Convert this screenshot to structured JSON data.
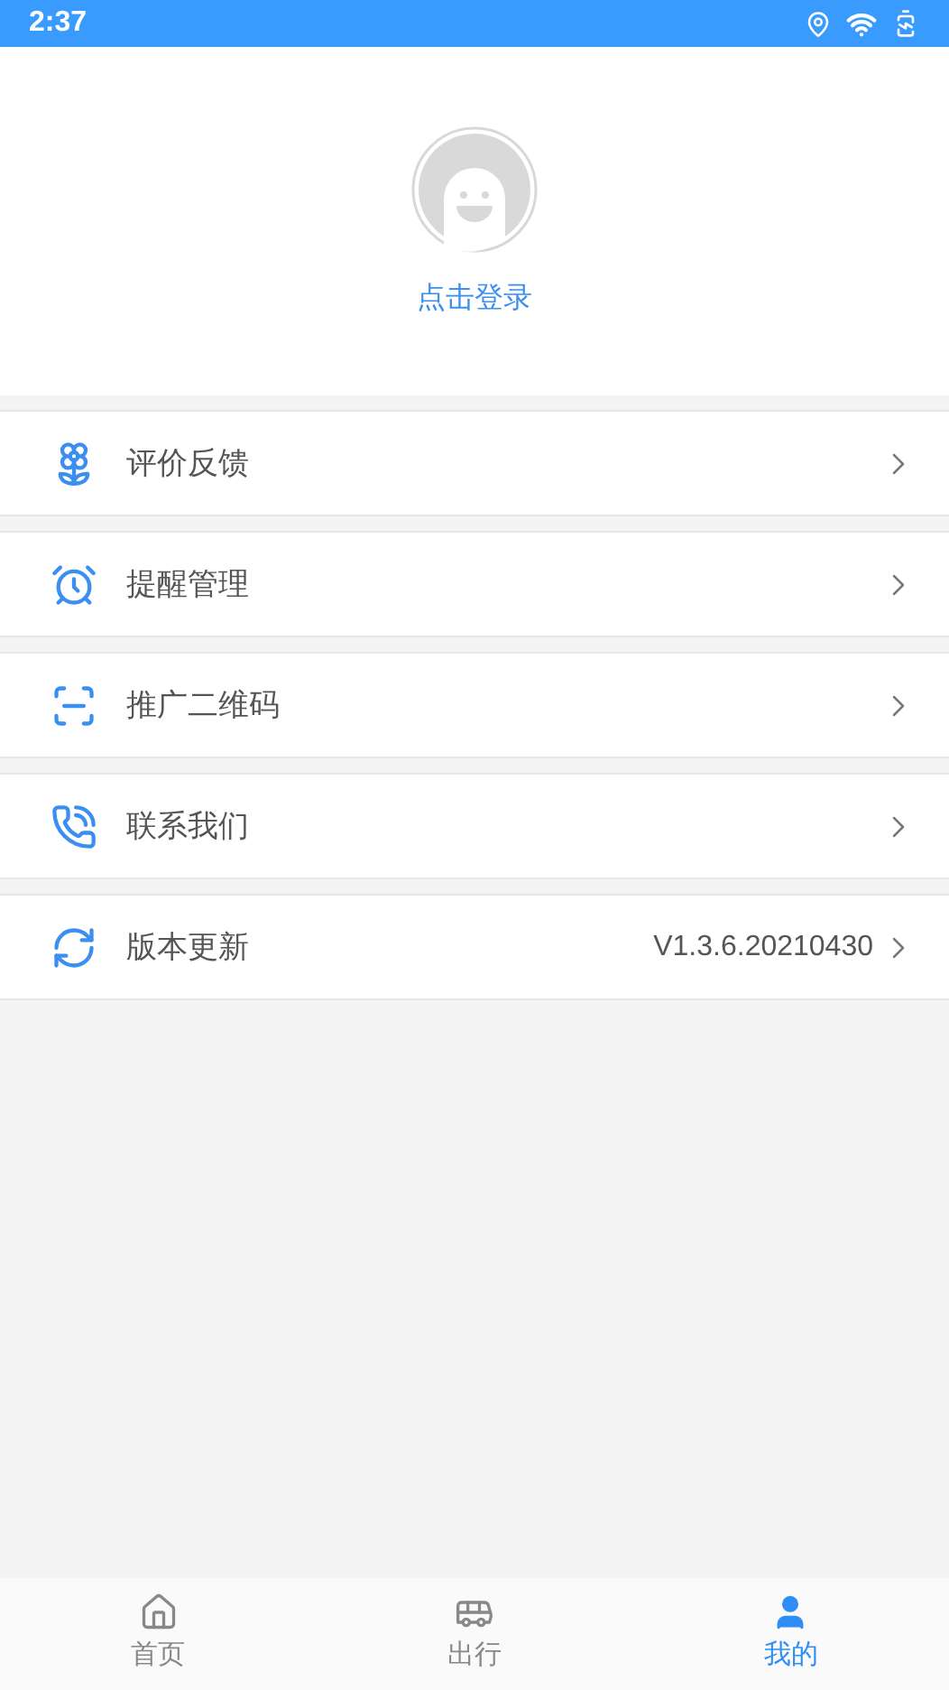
{
  "status_bar": {
    "time": "2:37"
  },
  "profile": {
    "login_label": "点击登录"
  },
  "menu": [
    {
      "kind": "feedback",
      "label": "评价反馈"
    },
    {
      "kind": "reminder",
      "label": "提醒管理"
    },
    {
      "kind": "qrcode",
      "label": "推广二维码"
    },
    {
      "kind": "contact",
      "label": "联系我们"
    },
    {
      "kind": "update",
      "label": "版本更新",
      "value": "V1.3.6.20210430"
    }
  ],
  "tab_bar": [
    {
      "kind": "home",
      "label": "首页",
      "selected": false
    },
    {
      "kind": "travel",
      "label": "出行",
      "selected": false
    },
    {
      "kind": "mine",
      "label": "我的",
      "selected": true
    }
  ]
}
